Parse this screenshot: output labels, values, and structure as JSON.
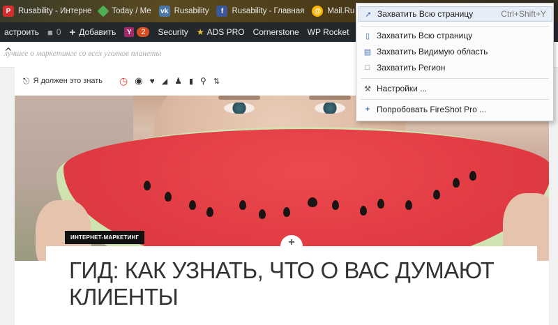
{
  "bookmarks": [
    {
      "label": "Rusability - Интерне",
      "icon": "pinterest-like-icon"
    },
    {
      "label": "Today / Me",
      "icon": "feedly-icon"
    },
    {
      "label": "Rusability",
      "icon": "vk-icon"
    },
    {
      "label": "Rusability - Главная",
      "icon": "facebook-icon"
    },
    {
      "label": "Mail.Ru",
      "icon": "mailru-icon"
    }
  ],
  "adminbar": {
    "customize": "астроить",
    "comments_count": "0",
    "add_label": "Добавить",
    "yoast_badge": "2",
    "security": "Security",
    "ads_pro": "ADS PRO",
    "cornerstone": "Cornerstone",
    "wp_rocket": "WP Rocket"
  },
  "tagline": "лучшее о маркетинге со всех уголков планеты",
  "actions": {
    "must_know": "Я должен это знать"
  },
  "post": {
    "category": "ИНТЕРНЕТ-МАРКЕТИНГ",
    "title": "ГИД: КАК УЗНАТЬ, ЧТО О ВАС ДУМАЮТ КЛИЕНТЫ"
  },
  "menu": {
    "items": [
      {
        "label": "Захватить Всю страницу",
        "shortcut": "Ctrl+Shift+Y",
        "icon": "capture-icon"
      },
      {
        "label": "Захватить Всю страницу",
        "icon": "page-icon"
      },
      {
        "label": "Захватить Видимую область",
        "icon": "visible-area-icon"
      },
      {
        "label": "Захватить Регион",
        "icon": "region-icon"
      },
      {
        "label": "Настройки ...",
        "icon": "settings-icon"
      },
      {
        "label": "Попробовать FireShot Pro ...",
        "icon": "plus-icon"
      }
    ]
  }
}
